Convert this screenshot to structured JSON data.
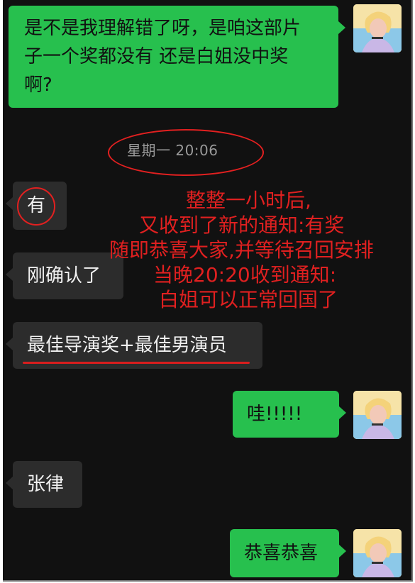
{
  "messages": {
    "m1": {
      "line1": "是不是我理解错了呀，是咱这部片",
      "line2": "子一个奖都没有 还是白姐没中奖",
      "line3": "啊?"
    },
    "timestamp": "星期一 20:06",
    "m2": "有",
    "m3": "刚确认了",
    "m4": "最佳导演奖+最佳男演员",
    "m5": "哇!!!!!",
    "m6": "张律",
    "m7": "恭喜恭喜"
  },
  "annotation": {
    "lines": [
      "整整一小时后,",
      "又收到了新的通知:有奖",
      "随即恭喜大家,并等待召回安排",
      "当晚20:20收到通知:",
      "白姐可以正常回国了"
    ]
  },
  "colors": {
    "background": "#111111",
    "outgoing_bubble": "#27c04e",
    "incoming_bubble": "#2c2c2c",
    "annotation_red": "#e02020"
  },
  "icons": {
    "avatar": "user-avatar-illustration"
  }
}
